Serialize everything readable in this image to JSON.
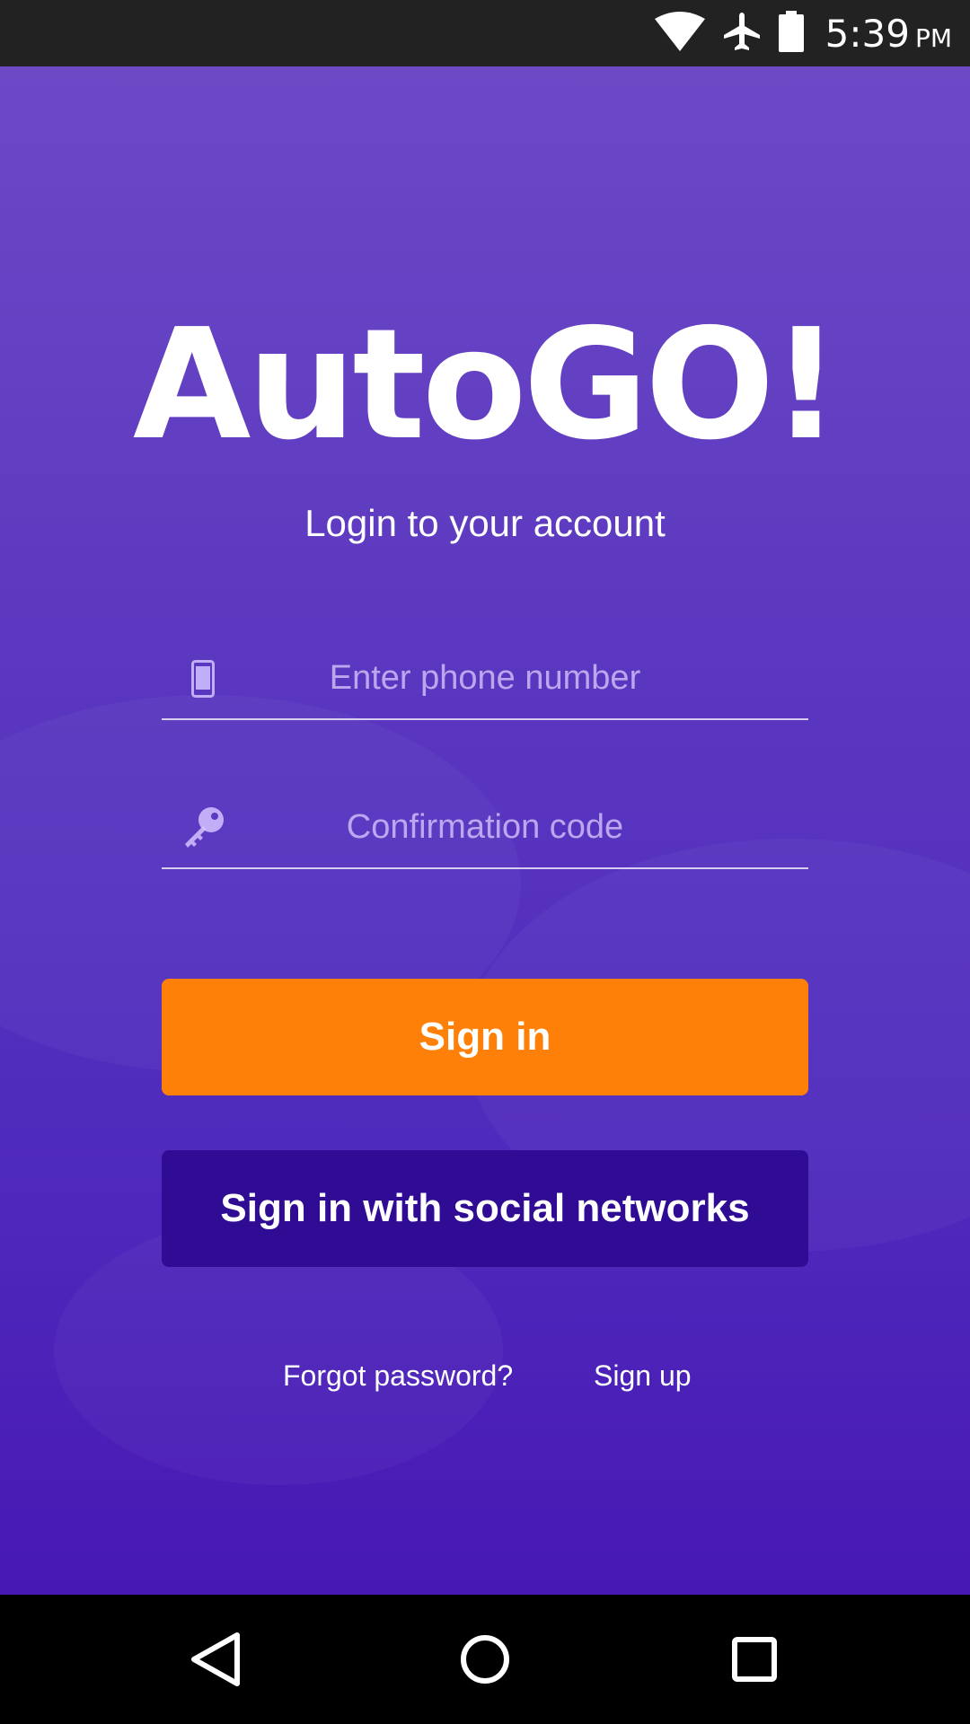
{
  "status_bar": {
    "time": "5:39",
    "ampm": "PM",
    "icons": [
      "wifi-icon",
      "airplane-mode-icon",
      "battery-icon"
    ]
  },
  "app": {
    "logo_text": "AutoGO!",
    "subtitle": "Login to your account"
  },
  "form": {
    "phone": {
      "icon": "phone-icon",
      "placeholder": "Enter phone number",
      "value": ""
    },
    "code": {
      "icon": "key-icon",
      "placeholder": "Confirmation code",
      "value": ""
    }
  },
  "buttons": {
    "sign_in": "Sign in",
    "social": "Sign in with social networks"
  },
  "links": {
    "forgot": "Forgot password?",
    "sign_up": "Sign up"
  },
  "nav_bar": {
    "icons": [
      "back-icon",
      "home-icon",
      "recents-icon"
    ]
  },
  "colors": {
    "background_top": "#6d49c6",
    "background_bottom": "#4818b4",
    "primary_button": "#fe8008",
    "secondary_button": "#300c94",
    "status_bar": "#222222"
  }
}
